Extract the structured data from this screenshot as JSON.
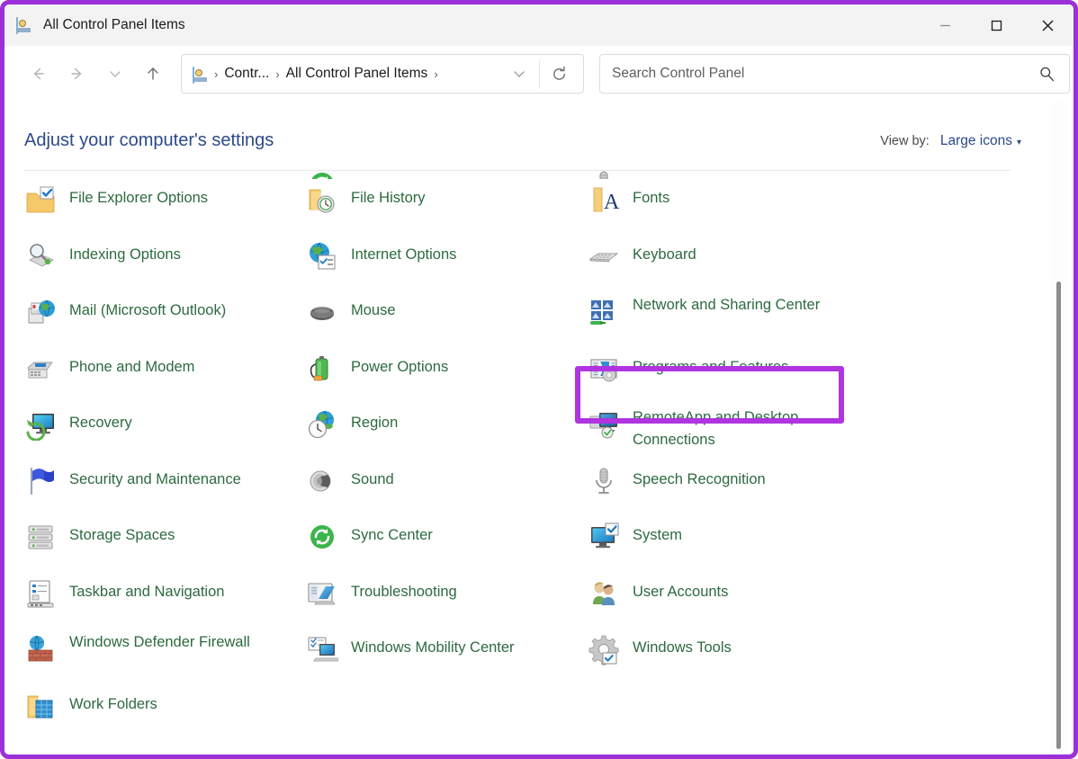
{
  "window": {
    "title": "All Control Panel Items",
    "title_icon": "control-panel-icon",
    "controls": {
      "minimize": "–",
      "maximize": "□",
      "close": "✕"
    }
  },
  "toolbar": {
    "back_label": "Back",
    "forward_label": "Forward",
    "recent_label": "Recent locations",
    "up_label": "Up",
    "refresh_label": "Refresh",
    "address_chevron_label": "Previous locations",
    "breadcrumb": {
      "icon": "control-panel-icon",
      "separator": "›",
      "items": [
        "Contr...",
        "All Control Panel Items"
      ],
      "trailing_separator": "›"
    },
    "search": {
      "placeholder": "Search Control Panel",
      "value": "",
      "icon": "search-icon"
    }
  },
  "content": {
    "heading": "Adjust your computer's settings",
    "view_by": {
      "label": "View by:",
      "value": "Large icons",
      "caret": "▾"
    }
  },
  "items": [
    {
      "label": "",
      "icon": "keyboard-partial-icon",
      "clipped": true
    },
    {
      "label": "",
      "icon": "sync-partial-icon",
      "clipped": true
    },
    {
      "label": "",
      "icon": "speech-partial-icon",
      "clipped": true
    },
    {
      "label": "File Explorer Options",
      "icon": "folder-check-icon"
    },
    {
      "label": "File History",
      "icon": "folder-clock-icon"
    },
    {
      "label": "Fonts",
      "icon": "fonts-icon"
    },
    {
      "label": "Indexing Options",
      "icon": "magnifier-index-icon"
    },
    {
      "label": "Internet Options",
      "icon": "globe-checklist-icon"
    },
    {
      "label": "Keyboard",
      "icon": "keyboard-icon"
    },
    {
      "label": "Mail (Microsoft Outlook)",
      "icon": "mail-globe-icon"
    },
    {
      "label": "Mouse",
      "icon": "mouse-icon"
    },
    {
      "label": "Network and Sharing Center",
      "icon": "network-sharing-icon",
      "two_line": true
    },
    {
      "label": "Phone and Modem",
      "icon": "fax-phone-icon"
    },
    {
      "label": "Power Options",
      "icon": "battery-plug-icon"
    },
    {
      "label": "Programs and Features",
      "icon": "programs-features-icon",
      "highlighted": true
    },
    {
      "label": "Recovery",
      "icon": "recovery-monitor-icon"
    },
    {
      "label": "Region",
      "icon": "globe-clock-icon"
    },
    {
      "label": "RemoteApp and Desktop Connections",
      "icon": "remoteapp-icon",
      "two_line": true
    },
    {
      "label": "Security and Maintenance",
      "icon": "blue-flag-icon"
    },
    {
      "label": "Sound",
      "icon": "speaker-icon"
    },
    {
      "label": "Speech Recognition",
      "icon": "microphone-icon"
    },
    {
      "label": "Storage Spaces",
      "icon": "storage-stack-icon"
    },
    {
      "label": "Sync Center",
      "icon": "sync-green-icon"
    },
    {
      "label": "System",
      "icon": "monitor-check-icon"
    },
    {
      "label": "Taskbar and Navigation",
      "icon": "taskbar-icon"
    },
    {
      "label": "Troubleshooting",
      "icon": "troubleshooting-icon"
    },
    {
      "label": "User Accounts",
      "icon": "users-icon"
    },
    {
      "label": "Windows Defender Firewall",
      "icon": "firewall-brick-icon",
      "two_line": true
    },
    {
      "label": "Windows Mobility Center",
      "icon": "mobility-center-icon"
    },
    {
      "label": "Windows Tools",
      "icon": "gear-check-icon"
    },
    {
      "label": "Work Folders",
      "icon": "work-folders-icon"
    },
    {
      "label": "",
      "icon": "",
      "empty": true
    },
    {
      "label": "",
      "icon": "",
      "empty": true
    }
  ],
  "colors": {
    "annotation_highlight": "#b034e0",
    "window_border": "#9b30d9",
    "item_label": "#2d6a3e",
    "heading": "#2c4a8a",
    "link": "#2c4a8a",
    "titlebar_bg": "#f3f3f3"
  }
}
